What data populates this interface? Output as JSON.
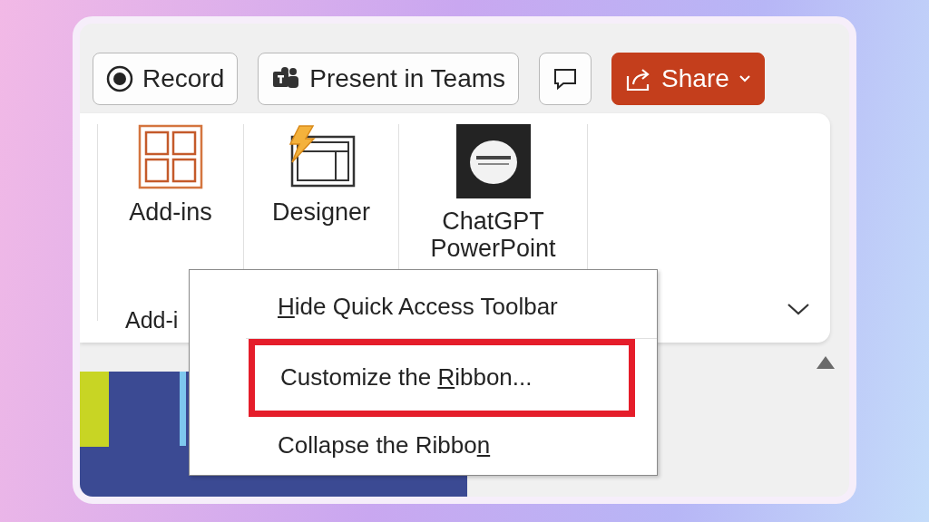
{
  "toolbar": [
    {
      "kind": "record",
      "label": "Record"
    },
    {
      "kind": "teams",
      "label": "Present in Teams"
    },
    {
      "kind": "comment"
    },
    {
      "kind": "share",
      "label": "Share"
    }
  ],
  "ribbon": {
    "buttons": [
      {
        "kind": "addins",
        "label": "Add-ins"
      },
      {
        "kind": "designer",
        "label": "Designer"
      },
      {
        "kind": "gpt",
        "label": "ChatGPT",
        "label_2": "PowerPoint"
      }
    ],
    "group_label": "Add-i"
  },
  "context_menu": [
    {
      "key": "H",
      "post": "ide Quick Access Toolbar",
      "highlighted": false
    },
    {
      "pre": "Customize the ",
      "key": "R",
      "post": "ibbon...",
      "highlighted": true
    },
    {
      "pre": "Collapse the Ribbo",
      "key": "n",
      "highlighted": false
    }
  ]
}
